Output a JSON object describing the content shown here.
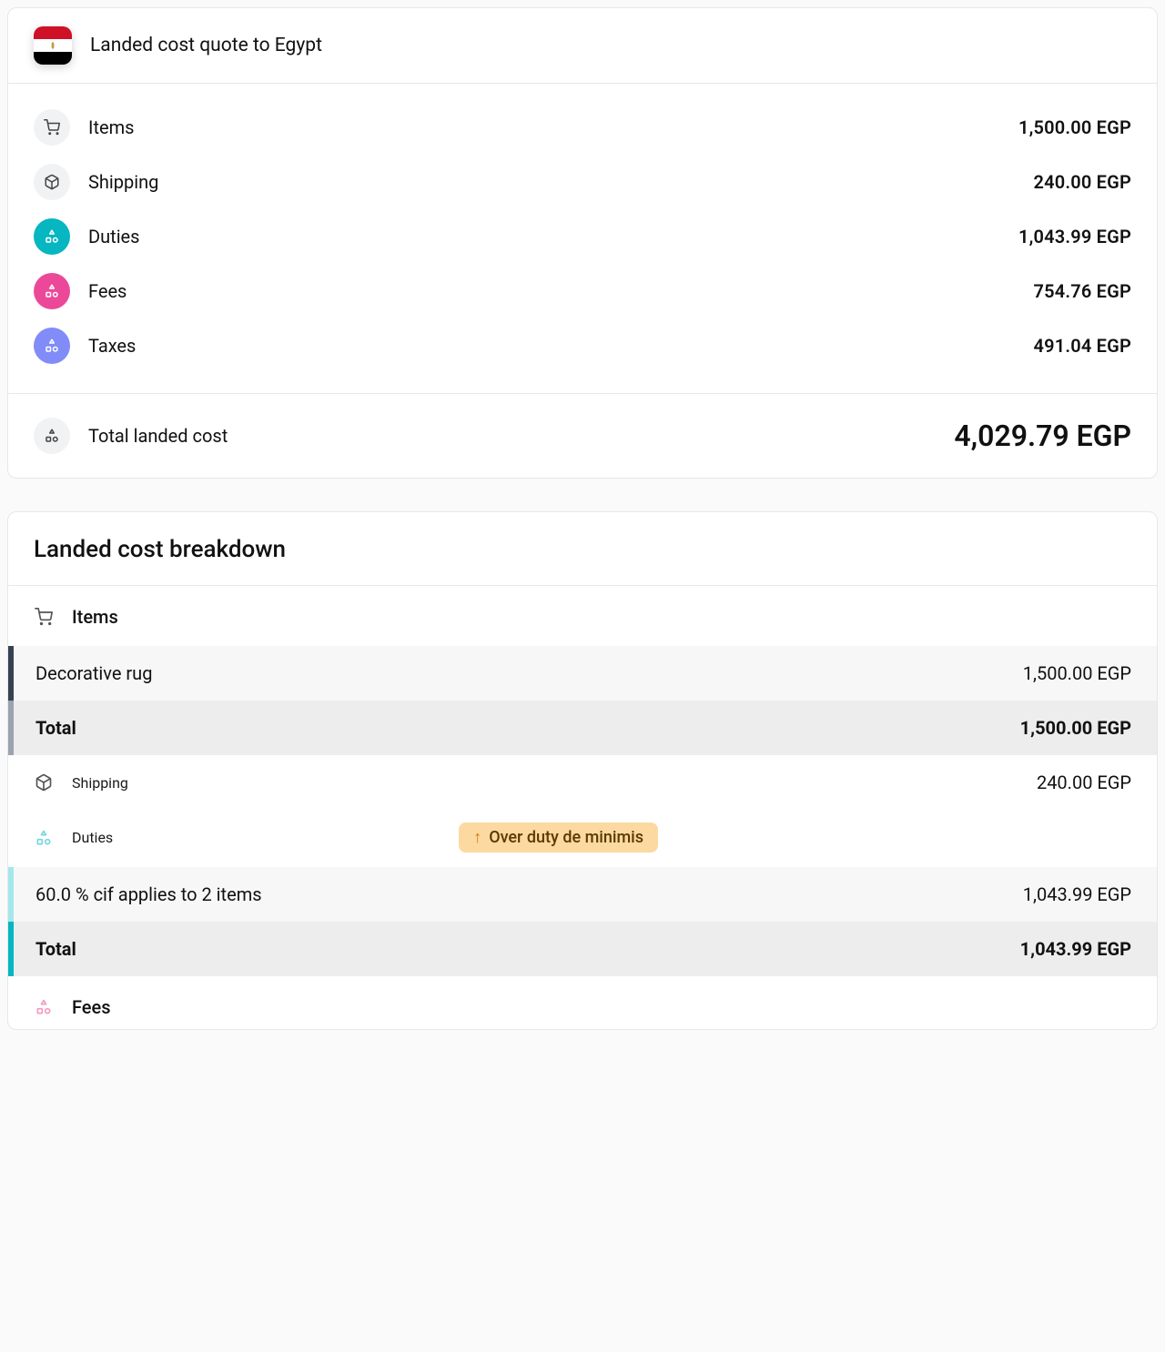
{
  "header": {
    "title": "Landed cost quote to Egypt"
  },
  "summary": {
    "items": {
      "label": "Items",
      "value": "1,500.00 EGP"
    },
    "shipping": {
      "label": "Shipping",
      "value": "240.00 EGP"
    },
    "duties": {
      "label": "Duties",
      "value": "1,043.99 EGP"
    },
    "fees": {
      "label": "Fees",
      "value": "754.76 EGP"
    },
    "taxes": {
      "label": "Taxes",
      "value": "491.04 EGP"
    },
    "total": {
      "label": "Total landed cost",
      "value": "4,029.79 EGP"
    }
  },
  "breakdown": {
    "title": "Landed cost breakdown",
    "items_section": {
      "label": "Items",
      "rows": [
        {
          "label": "Decorative rug",
          "value": "1,500.00 EGP"
        }
      ],
      "total": {
        "label": "Total",
        "value": "1,500.00 EGP"
      }
    },
    "shipping": {
      "label": "Shipping",
      "value": "240.00 EGP"
    },
    "duties_section": {
      "label": "Duties",
      "badge": "Over duty de minimis",
      "rows": [
        {
          "label": "60.0 % cif applies to 2 items",
          "value": "1,043.99 EGP"
        }
      ],
      "total": {
        "label": "Total",
        "value": "1,043.99 EGP"
      }
    },
    "fees_section": {
      "label": "Fees"
    }
  }
}
